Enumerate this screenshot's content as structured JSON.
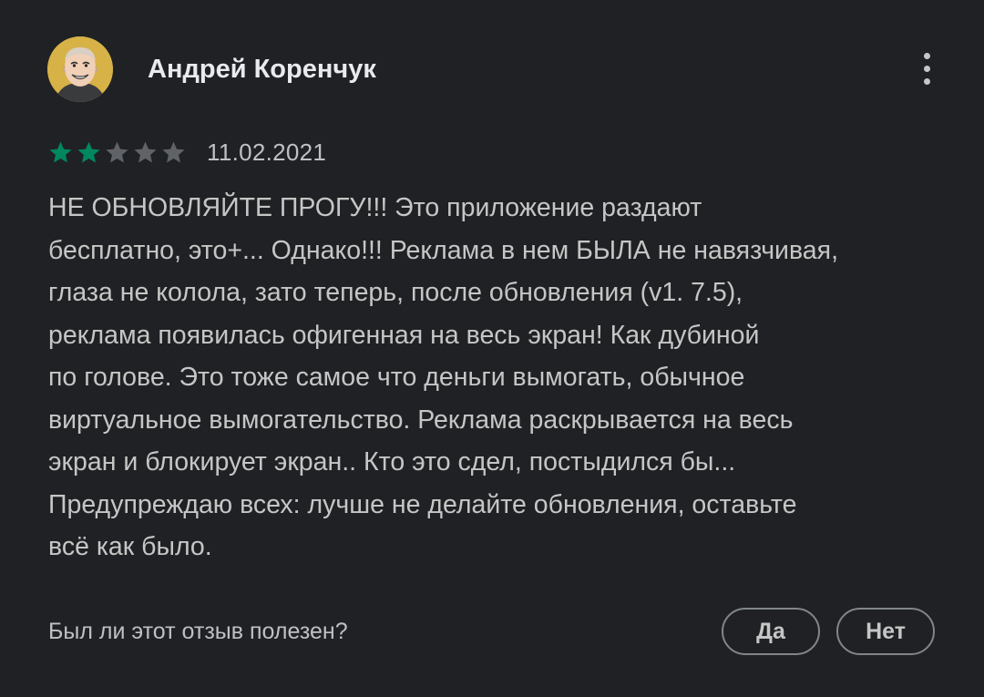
{
  "review": {
    "author": "Андрей Коренчук",
    "avatar_icon": "avatar-photo",
    "menu_icon": "more-vert-icon",
    "rating": 2,
    "max_rating": 5,
    "star_color_filled": "#01875f",
    "star_color_empty": "#5f6368",
    "date": "11.02.2021",
    "text": "НЕ ОБНОВЛЯЙТЕ ПРОГУ!!! Это приложение раздают\nбесплатно, это+... Однако!!! Реклама в нем БЫЛА не навязчивая,\nглаза не колола, зато теперь, после обновления (v1. 7.5),\nреклама появилась офигенная на весь экран! Как дубиной\nпо голове. Это тоже самое что деньги вымогать, обычное\nвиртуальное вымогательство. Реклама раскрывается на весь\nэкран и блокирует экран.. Кто это сдел, постыдился бы...\nПредупреждаю всех: лучше не делайте обновления, оставьте\nвсё как было."
  },
  "feedback": {
    "question": "Был ли этот отзыв полезен?",
    "yes_label": "Да",
    "no_label": "Нет"
  },
  "colors": {
    "background": "#202124",
    "text_primary": "#e8eaed",
    "text_secondary": "#c4c7c5",
    "button_border": "#80868b"
  }
}
